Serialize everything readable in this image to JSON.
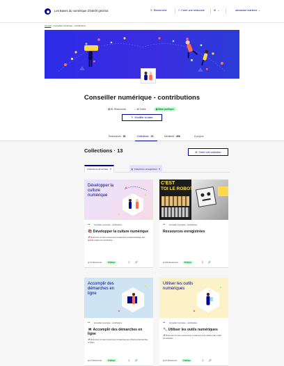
{
  "header": {
    "site_title": "Les Bases du numérique d'intérêt général",
    "search_label": "Rechercher",
    "create_resource_label": "Créer une ressource",
    "user_name": "alexandre martinez"
  },
  "breadcrumb": {
    "home": "Accueil",
    "separator": ">",
    "current": "Conseiller numérique - contributions"
  },
  "base": {
    "title": "Conseiller numérique - contributions",
    "resources_count": "81 Ressources",
    "followers_count": "46 Suivis",
    "visibility": "Base publique",
    "edit_label": "Modifier la base"
  },
  "tabs": [
    {
      "label": "Ressources",
      "count": "81"
    },
    {
      "label": "Collections",
      "count": "13"
    },
    {
      "label": "Membres",
      "count": "406"
    },
    {
      "label": "À propos",
      "count": ""
    }
  ],
  "collections": {
    "title": "Collections · 13",
    "create_label": "Créer une collection",
    "subtab_base": "Collections de la base · 8",
    "subtab_saved": "Collections enregistrées · 5"
  },
  "cards": [
    {
      "owner": "Conseiller numérique - contributions",
      "image_text": "Développer la culture numérique",
      "title": "Développer la culture numérique",
      "description": "Retrouvez ici des ressources consacrées à l'apprentissage des grands enjeux du numérique",
      "resources": "47 Ressources",
      "visibility": "Publique",
      "theme": "pink"
    },
    {
      "owner": "Conseiller numérique - contributions",
      "image_text": "",
      "title": "Ressources enregistrées",
      "description": "",
      "resources": "196 Ressources",
      "visibility": "Publique",
      "theme": "photo"
    },
    {
      "owner": "Conseiller numérique - contributions",
      "image_text": "Accomplir des démarches en ligne",
      "title": "Accomplir des démarches en ligne",
      "description": "Retrouvez ici des ressources consacrées aux diverses démarches en ligne",
      "resources": "27 Ressources",
      "visibility": "Publique",
      "theme": "blue"
    },
    {
      "owner": "Conseiller numérique - contributions",
      "image_text": "Utiliser les outils numériques",
      "title": "Utiliser les outils numériques",
      "description": "Retrouvez ici des ressources consacrées à la maîtrise des outils numériques",
      "resources": "67 Ressources",
      "visibility": "Publique",
      "theme": "yellow"
    }
  ],
  "photo_text": {
    "line1": "C'EST",
    "line2": "TOI LE ROBOT"
  },
  "colors": {
    "primary": "#000091",
    "banner": "#2c2ce8",
    "success_bg": "#b8fec9",
    "success_text": "#18753c"
  }
}
